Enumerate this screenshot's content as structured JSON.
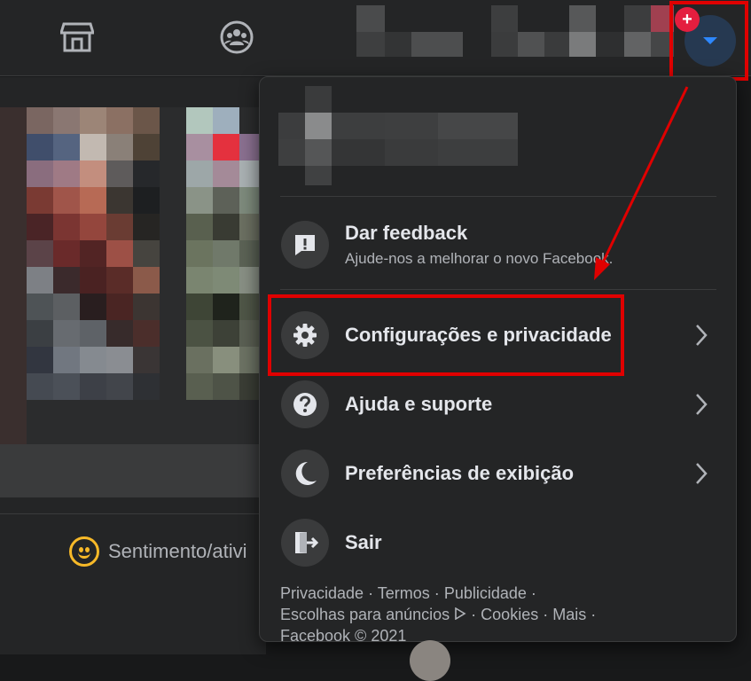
{
  "topbar": {
    "marketplace_icon": "store-icon",
    "groups_icon": "groups-icon",
    "account_button_icon": "caret-down-icon",
    "notification_badge": "+"
  },
  "feed": {
    "feeling_label": "Sentimento/ativi"
  },
  "menu": {
    "items": [
      {
        "title": "Dar feedback",
        "subtitle": "Ajude-nos a melhorar o novo Facebook.",
        "icon": "feedback-icon"
      },
      {
        "title": "Configurações e privacidade",
        "icon": "gear-icon"
      },
      {
        "title": "Ajuda e suporte",
        "icon": "help-icon"
      },
      {
        "title": "Preferências de exibição",
        "icon": "moon-icon"
      },
      {
        "title": "Sair",
        "icon": "logout-icon"
      }
    ],
    "footer": {
      "links": [
        "Privacidade",
        "Termos",
        "Publicidade",
        "Escolhas para anúncios",
        "Cookies",
        "Mais"
      ],
      "copyright": "Facebook © 2021",
      "separator": "·"
    }
  },
  "colors": {
    "background": "#18191a",
    "surface": "#242526",
    "accent": "#2d88ff",
    "highlight": "#e00000",
    "text_primary": "#e4e6eb",
    "text_secondary": "#b0b3b8"
  }
}
